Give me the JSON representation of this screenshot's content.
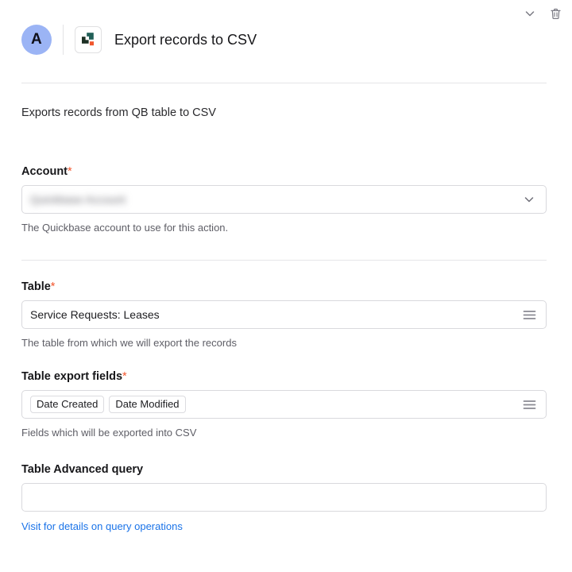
{
  "window": {
    "collapse_icon": "chevron-down-icon",
    "delete_icon": "trash-icon"
  },
  "header": {
    "avatar_letter": "A",
    "app_icon": "quickbase-logo-icon",
    "title": "Export records to CSV"
  },
  "description": "Exports records from QB table to CSV",
  "fields": {
    "account": {
      "label": "Account",
      "required_marker": "*",
      "value": "Quickbase  Account",
      "redacted": true,
      "adorn_icon": "chevron-down-icon",
      "help": "The Quickbase account to use for this action."
    },
    "table": {
      "label": "Table",
      "required_marker": "*",
      "value": "Service Requests: Leases",
      "adorn_icon": "list-menu-icon",
      "help": "The table from which we will export the records"
    },
    "export_fields": {
      "label": "Table export fields",
      "required_marker": "*",
      "chips": [
        "Date Created",
        "Date Modified"
      ],
      "adorn_icon": "list-menu-icon",
      "help": "Fields which will be exported into CSV"
    },
    "advanced_query": {
      "label": "Table Advanced query",
      "required_marker": "",
      "value": "",
      "placeholder": "",
      "link": "Visit for details on query operations"
    }
  },
  "colors": {
    "required_asterisk": "#f2552c",
    "link": "#1a73e8",
    "avatar_bg": "#9bb4f5",
    "logo_dark_green": "#1d3024",
    "logo_teal": "#215f57",
    "logo_orange": "#f0562d",
    "border": "#d9d9dd",
    "divider": "#e6e6e8"
  }
}
